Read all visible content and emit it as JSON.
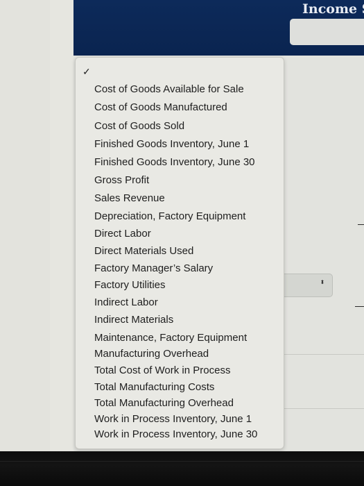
{
  "header": {
    "title": "Income S",
    "input_value": ""
  },
  "dropdown": {
    "selected_checkmark": "✓",
    "options": [
      "Cost of Goods Available for Sale",
      "Cost of Goods Manufactured",
      "Cost of Goods Sold",
      "Finished Goods Inventory, June 1",
      "Finished Goods Inventory, June 30",
      "Gross Profit",
      "Sales Revenue",
      "Depreciation, Factory Equipment",
      "Direct Labor",
      "Direct Materials Used",
      "Factory Manager’s Salary",
      "Factory Utilities",
      "Indirect Labor",
      "Indirect Materials",
      "Maintenance, Factory Equipment",
      "Manufacturing Overhead",
      "Total Cost of Work in Process",
      "Total Manufacturing Costs",
      "Total Manufacturing Overhead",
      "Work in Process Inventory, June 1",
      "Work in Process Inventory, June 30"
    ]
  },
  "right_select": {
    "value": "",
    "stepper_icon": "⬍"
  },
  "colors": {
    "header_bg": "#0b2654",
    "menu_bg": "#e9e9e4",
    "text": "#1e1e1e"
  }
}
